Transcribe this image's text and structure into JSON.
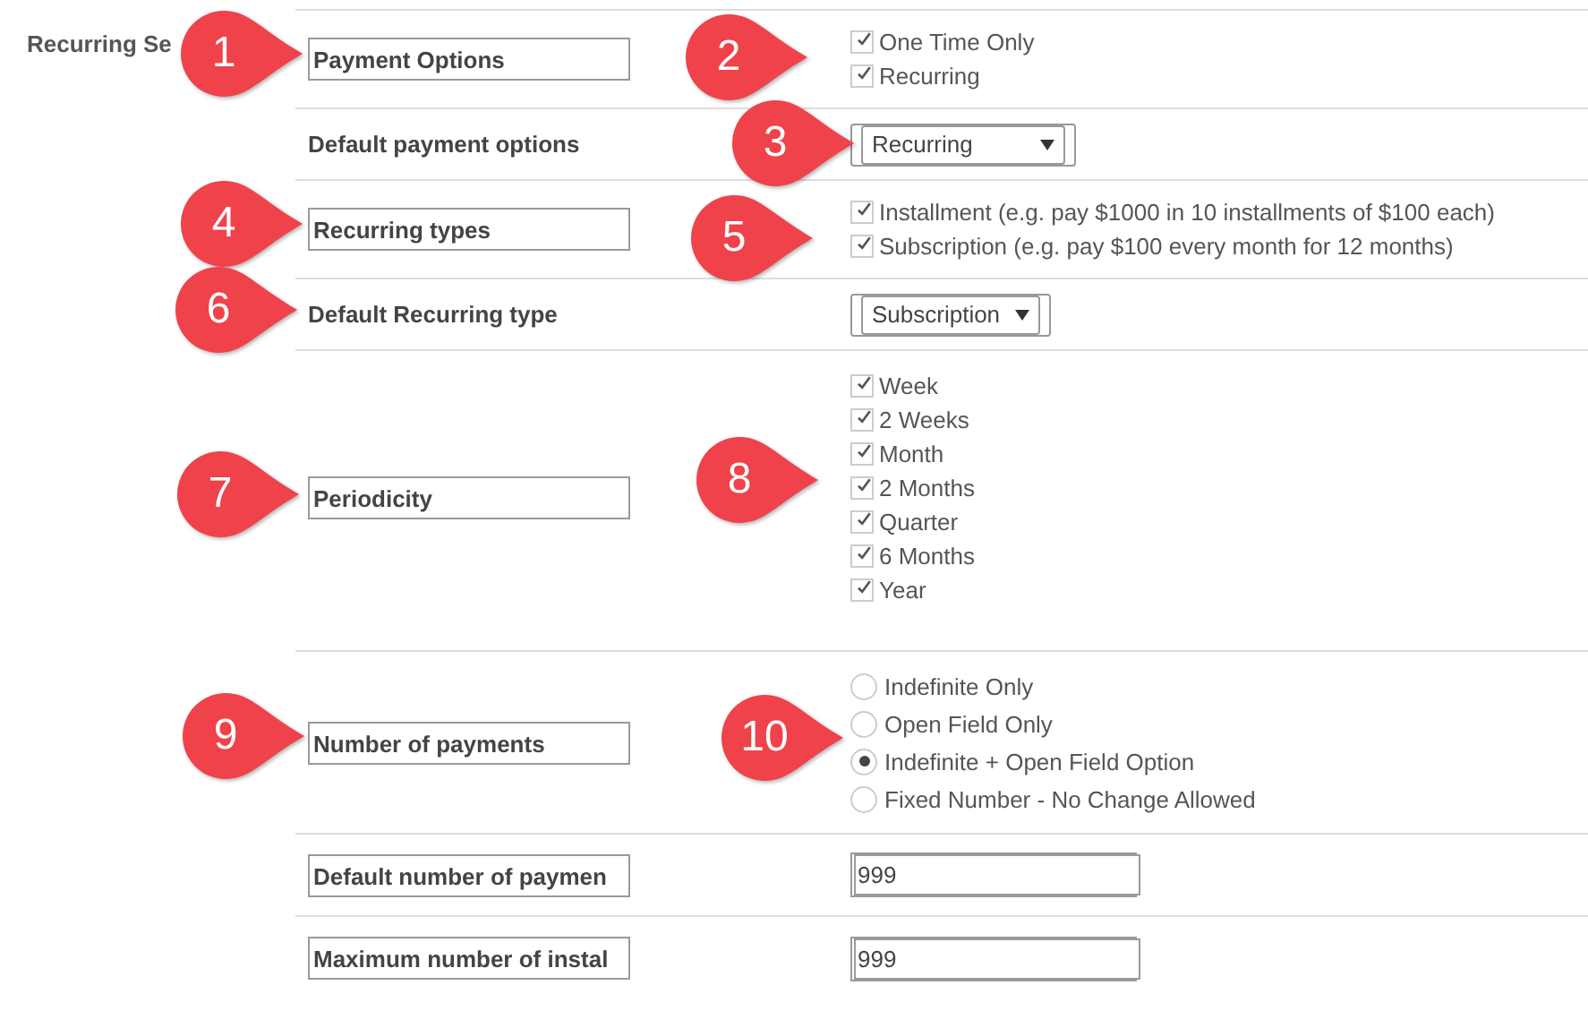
{
  "section_title": "Recurring Se",
  "rows": [
    {
      "label": "Payment Options",
      "boxed": true,
      "kind": "checkboxes",
      "options": [
        {
          "label": "One Time Only",
          "checked": true
        },
        {
          "label": "Recurring",
          "checked": true
        }
      ]
    },
    {
      "label": "Default payment options",
      "boxed": false,
      "kind": "select",
      "value": "Recurring"
    },
    {
      "label": "Recurring types",
      "boxed": true,
      "kind": "checkboxes",
      "options": [
        {
          "label": "Installment (e.g. pay $1000 in 10 installments of $100 each)",
          "checked": true
        },
        {
          "label": "Subscription (e.g. pay $100 every month for 12 months)",
          "checked": true
        }
      ]
    },
    {
      "label": "Default Recurring type",
      "boxed": false,
      "kind": "select",
      "value": "Subscription"
    },
    {
      "label": "Periodicity",
      "boxed": true,
      "kind": "checkboxes",
      "options": [
        {
          "label": "Week",
          "checked": true
        },
        {
          "label": "2 Weeks",
          "checked": true
        },
        {
          "label": "Month",
          "checked": true
        },
        {
          "label": "2 Months",
          "checked": true
        },
        {
          "label": "Quarter",
          "checked": true
        },
        {
          "label": "6 Months",
          "checked": true
        },
        {
          "label": "Year",
          "checked": true
        }
      ]
    },
    {
      "label": "Number of payments",
      "boxed": true,
      "kind": "radios",
      "options": [
        {
          "label": "Indefinite Only",
          "selected": false
        },
        {
          "label": "Open Field Only",
          "selected": false
        },
        {
          "label": "Indefinite + Open Field Option",
          "selected": true
        },
        {
          "label": "Fixed Number - No Change Allowed",
          "selected": false
        }
      ]
    },
    {
      "label": "Default number of paymen",
      "boxed": true,
      "kind": "input",
      "value": "999"
    },
    {
      "label": "Maximum number of instal",
      "boxed": true,
      "kind": "input",
      "value": "999"
    }
  ],
  "callouts": [
    {
      "number": "1"
    },
    {
      "number": "2"
    },
    {
      "number": "3"
    },
    {
      "number": "4"
    },
    {
      "number": "5"
    },
    {
      "number": "6"
    },
    {
      "number": "7"
    },
    {
      "number": "8"
    },
    {
      "number": "9"
    },
    {
      "number": "10"
    }
  ]
}
